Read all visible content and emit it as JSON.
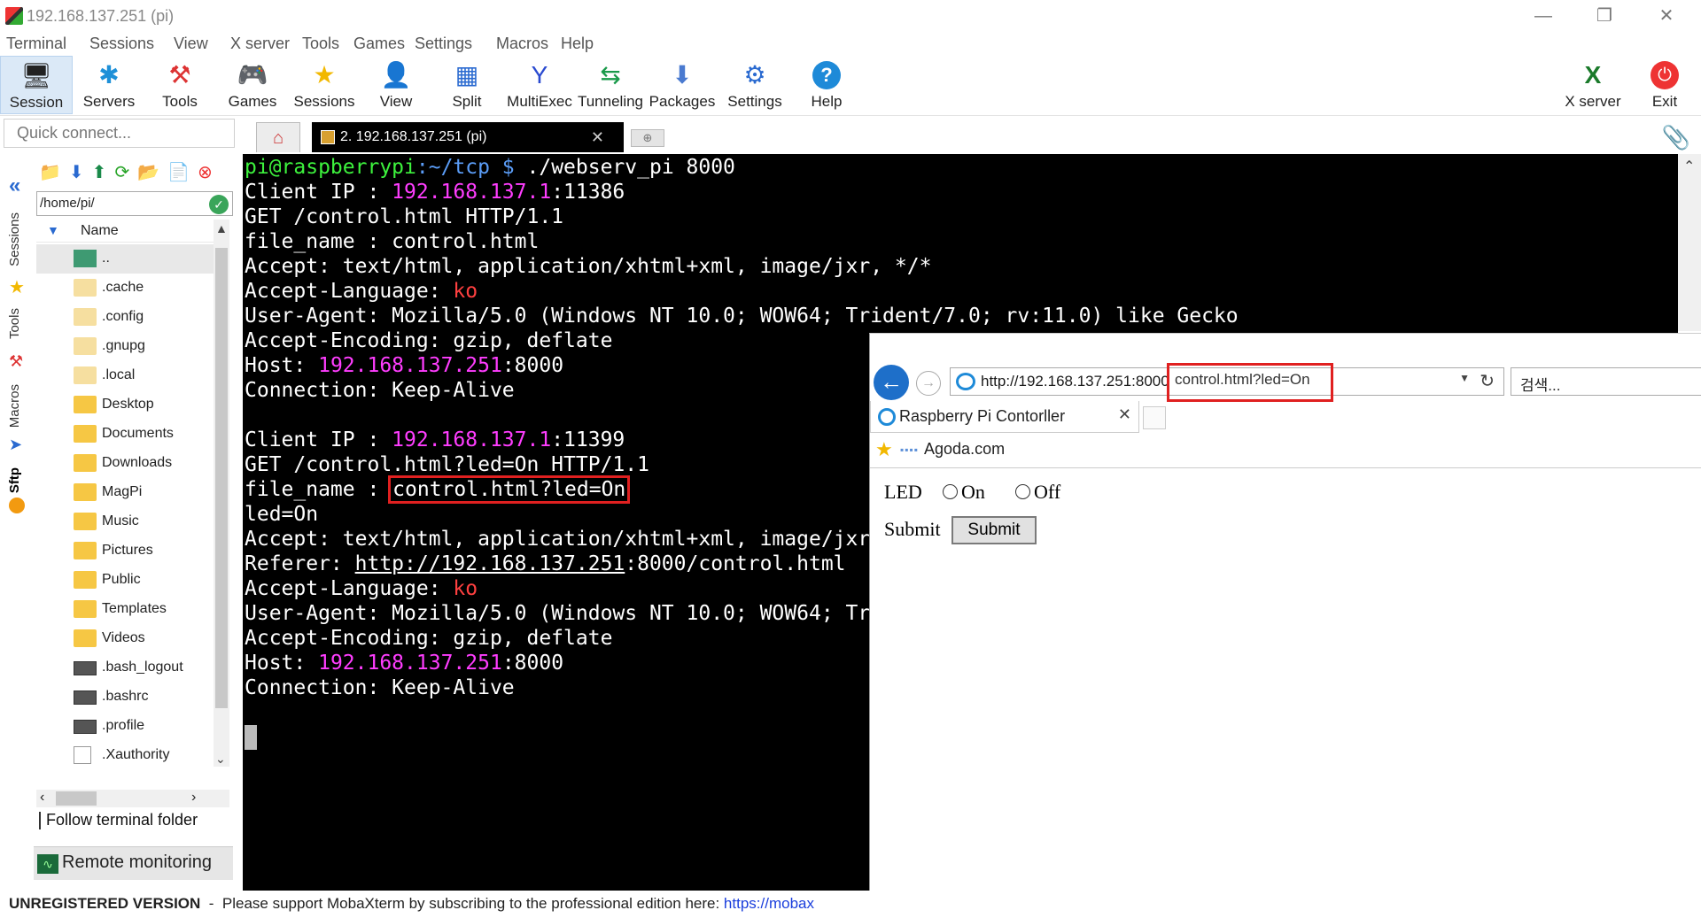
{
  "window": {
    "title": "192.168.137.251 (pi)"
  },
  "menu": [
    "Terminal",
    "Sessions",
    "View",
    "X server",
    "Tools",
    "Games",
    "Settings",
    "Macros",
    "Help"
  ],
  "toolbar": {
    "buttons": [
      {
        "label": "Session",
        "icon": "monitor-icon"
      },
      {
        "label": "Servers",
        "icon": "servers-icon"
      },
      {
        "label": "Tools",
        "icon": "tools-icon"
      },
      {
        "label": "Games",
        "icon": "gamepad-icon"
      },
      {
        "label": "Sessions",
        "icon": "star-icon"
      },
      {
        "label": "View",
        "icon": "view-icon"
      },
      {
        "label": "Split",
        "icon": "split-icon"
      },
      {
        "label": "MultiExec",
        "icon": "multiexec-icon"
      },
      {
        "label": "Tunneling",
        "icon": "tunneling-icon"
      },
      {
        "label": "Packages",
        "icon": "packages-icon"
      },
      {
        "label": "Settings",
        "icon": "settings-icon"
      },
      {
        "label": "Help",
        "icon": "help-icon"
      }
    ],
    "right_buttons": [
      {
        "label": "X server",
        "icon": "xserver-icon"
      },
      {
        "label": "Exit",
        "icon": "power-icon"
      }
    ]
  },
  "quick_connect": {
    "placeholder": "Quick connect..."
  },
  "tabs": {
    "active": "2. 192.168.137.251 (pi)"
  },
  "side_tabs": [
    "Sessions",
    "Tools",
    "Macros",
    "Sftp"
  ],
  "sftp": {
    "path": "/home/pi/",
    "column": "Name",
    "files": [
      {
        "name": "..",
        "type": "up"
      },
      {
        "name": ".cache",
        "type": "folder-dim"
      },
      {
        "name": ".config",
        "type": "folder-dim"
      },
      {
        "name": ".gnupg",
        "type": "folder-dim"
      },
      {
        "name": ".local",
        "type": "folder-dim"
      },
      {
        "name": "Desktop",
        "type": "folder"
      },
      {
        "name": "Documents",
        "type": "folder"
      },
      {
        "name": "Downloads",
        "type": "folder"
      },
      {
        "name": "MagPi",
        "type": "folder"
      },
      {
        "name": "Music",
        "type": "folder"
      },
      {
        "name": "Pictures",
        "type": "folder"
      },
      {
        "name": "Public",
        "type": "folder"
      },
      {
        "name": "Templates",
        "type": "folder"
      },
      {
        "name": "Videos",
        "type": "folder"
      },
      {
        "name": ".bash_logout",
        "type": "term"
      },
      {
        "name": ".bashrc",
        "type": "term"
      },
      {
        "name": ".profile",
        "type": "term"
      },
      {
        "name": ".Xauthority",
        "type": "doc"
      }
    ],
    "follow_label": "Follow terminal folder",
    "remote_monitoring": "Remote monitoring"
  },
  "terminal": {
    "prompt_user": "pi@raspberrypi",
    "prompt_path": ":~/tcp $",
    "command": " ./webserv_pi 8000",
    "lines": [
      [
        {
          "t": "Client IP : "
        },
        {
          "t": "192.168.137.1",
          "c": "m"
        },
        {
          "t": ":11386"
        }
      ],
      [
        {
          "t": "GET /control.html HTTP/1.1"
        }
      ],
      [
        {
          "t": "file_name : control.html"
        }
      ],
      [
        {
          "t": "Accept: text/html, application/xhtml+xml, image/jxr, */*"
        }
      ],
      [
        {
          "t": "Accept-Language: "
        },
        {
          "t": "ko",
          "c": "r"
        }
      ],
      [
        {
          "t": "User-Agent: Mozilla/5.0 (Windows NT 10.0; WOW64; Trident/7.0; rv:11.0) like Gecko"
        }
      ],
      [
        {
          "t": "Accept-Encoding: gzip, deflate"
        }
      ],
      [
        {
          "t": "Host: "
        },
        {
          "t": "192.168.137.251",
          "c": "m"
        },
        {
          "t": ":8000"
        }
      ],
      [
        {
          "t": "Connection: Keep-Alive"
        }
      ],
      [
        {
          "t": ""
        }
      ],
      [
        {
          "t": "Client IP : "
        },
        {
          "t": "192.168.137.1",
          "c": "m"
        },
        {
          "t": ":11399"
        }
      ],
      [
        {
          "t": "GET /control.html?led=On HTTP/1.1"
        }
      ],
      [
        {
          "t": "file_name : "
        },
        {
          "t": "control.html?led=On",
          "c": "hl"
        }
      ],
      [
        {
          "t": "led=On"
        }
      ],
      [
        {
          "t": "Accept: text/html, application/xhtml+xml, image/jxr"
        }
      ],
      [
        {
          "t": "Referer: "
        },
        {
          "t": "http://192.168.137.251",
          "c": "u"
        },
        {
          "t": ":8000/control.html"
        }
      ],
      [
        {
          "t": "Accept-Language: "
        },
        {
          "t": "ko",
          "c": "r"
        }
      ],
      [
        {
          "t": "User-Agent: Mozilla/5.0 (Windows NT 10.0; WOW64; Tr"
        }
      ],
      [
        {
          "t": "Accept-Encoding: gzip, deflate"
        }
      ],
      [
        {
          "t": "Host: "
        },
        {
          "t": "192.168.137.251",
          "c": "m"
        },
        {
          "t": ":8000"
        }
      ],
      [
        {
          "t": "Connection: Keep-Alive"
        }
      ]
    ]
  },
  "browser": {
    "url_host": "http://192.168.137.251:8000",
    "url_path": "control.html?led=On",
    "search_placeholder": "검색...",
    "tab_title": "Raspberry Pi Contorller",
    "favorite": "Agoda.com",
    "form": {
      "led_label": "LED",
      "on_label": "On",
      "off_label": "Off",
      "submit_label": "Submit",
      "submit_button": "Submit"
    }
  },
  "statusbar": {
    "unregistered": "UNREGISTERED VERSION",
    "separator": "  -  ",
    "message": "Please support MobaXterm by subscribing to the professional edition here:  ",
    "link": "https://mobax"
  },
  "colors": {
    "prompt_green": "#3df23d",
    "path_blue": "#5b9df7",
    "ip_magenta": "#ff3dff",
    "highlight_red": "#e02020"
  }
}
